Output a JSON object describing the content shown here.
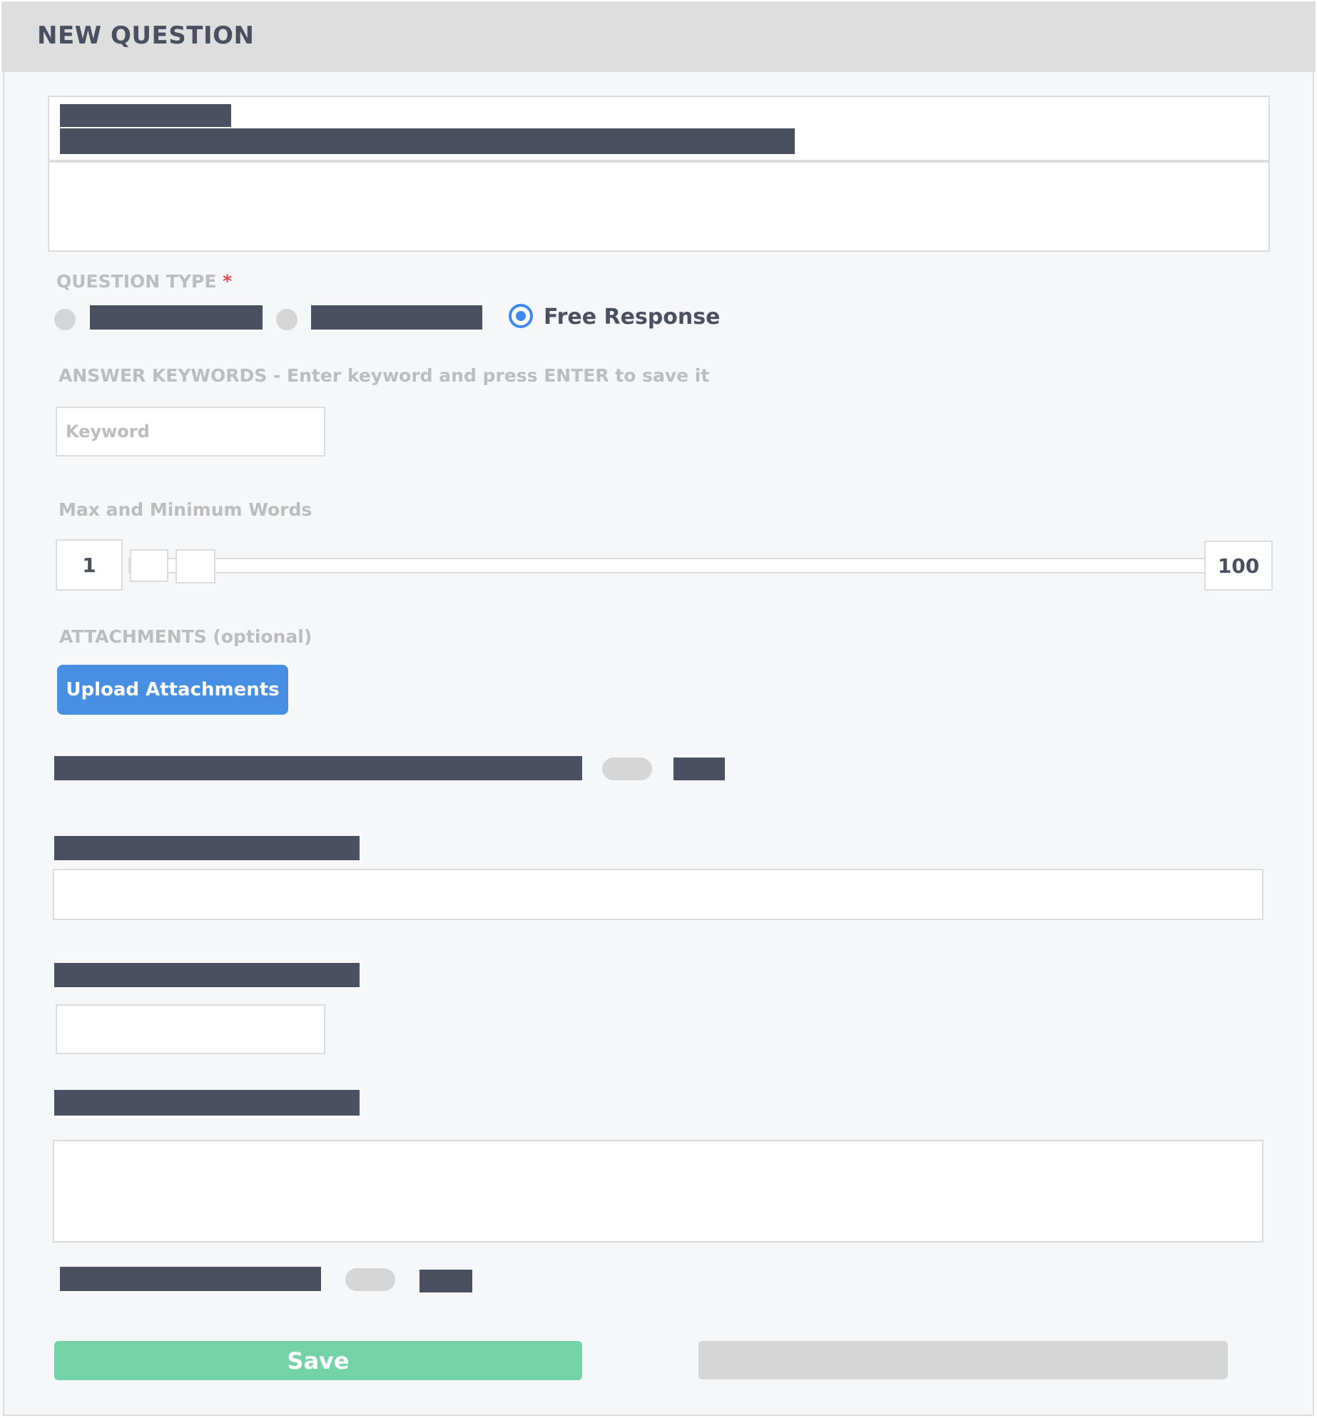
{
  "header": {
    "title": "NEW QUESTION"
  },
  "question_type": {
    "label": "QUESTION TYPE",
    "required_marker": "*",
    "options": [
      {
        "label": "[redacted]",
        "selected": false
      },
      {
        "label": "[redacted]",
        "selected": false
      },
      {
        "label": "Free Response",
        "selected": true
      }
    ]
  },
  "answer_keywords": {
    "label": "ANSWER KEYWORDS - Enter keyword and press ENTER to save it",
    "input_value": "",
    "input_placeholder": "Keyword"
  },
  "word_limits": {
    "label": "Max and Minimum Words",
    "min_value": "1",
    "max_value": "100"
  },
  "attachments": {
    "label": "ATTACHMENTS (optional)",
    "upload_button": "Upload Attachments"
  },
  "actions": {
    "save_label": "Save",
    "secondary_label": ""
  },
  "colors": {
    "accent_blue": "#3d88f2",
    "upload_button": "#468fe3",
    "save_button": "#75d3a8",
    "required": "#e04b4b",
    "text_dark": "#4a5060",
    "label_grey": "#bdbdbd"
  }
}
